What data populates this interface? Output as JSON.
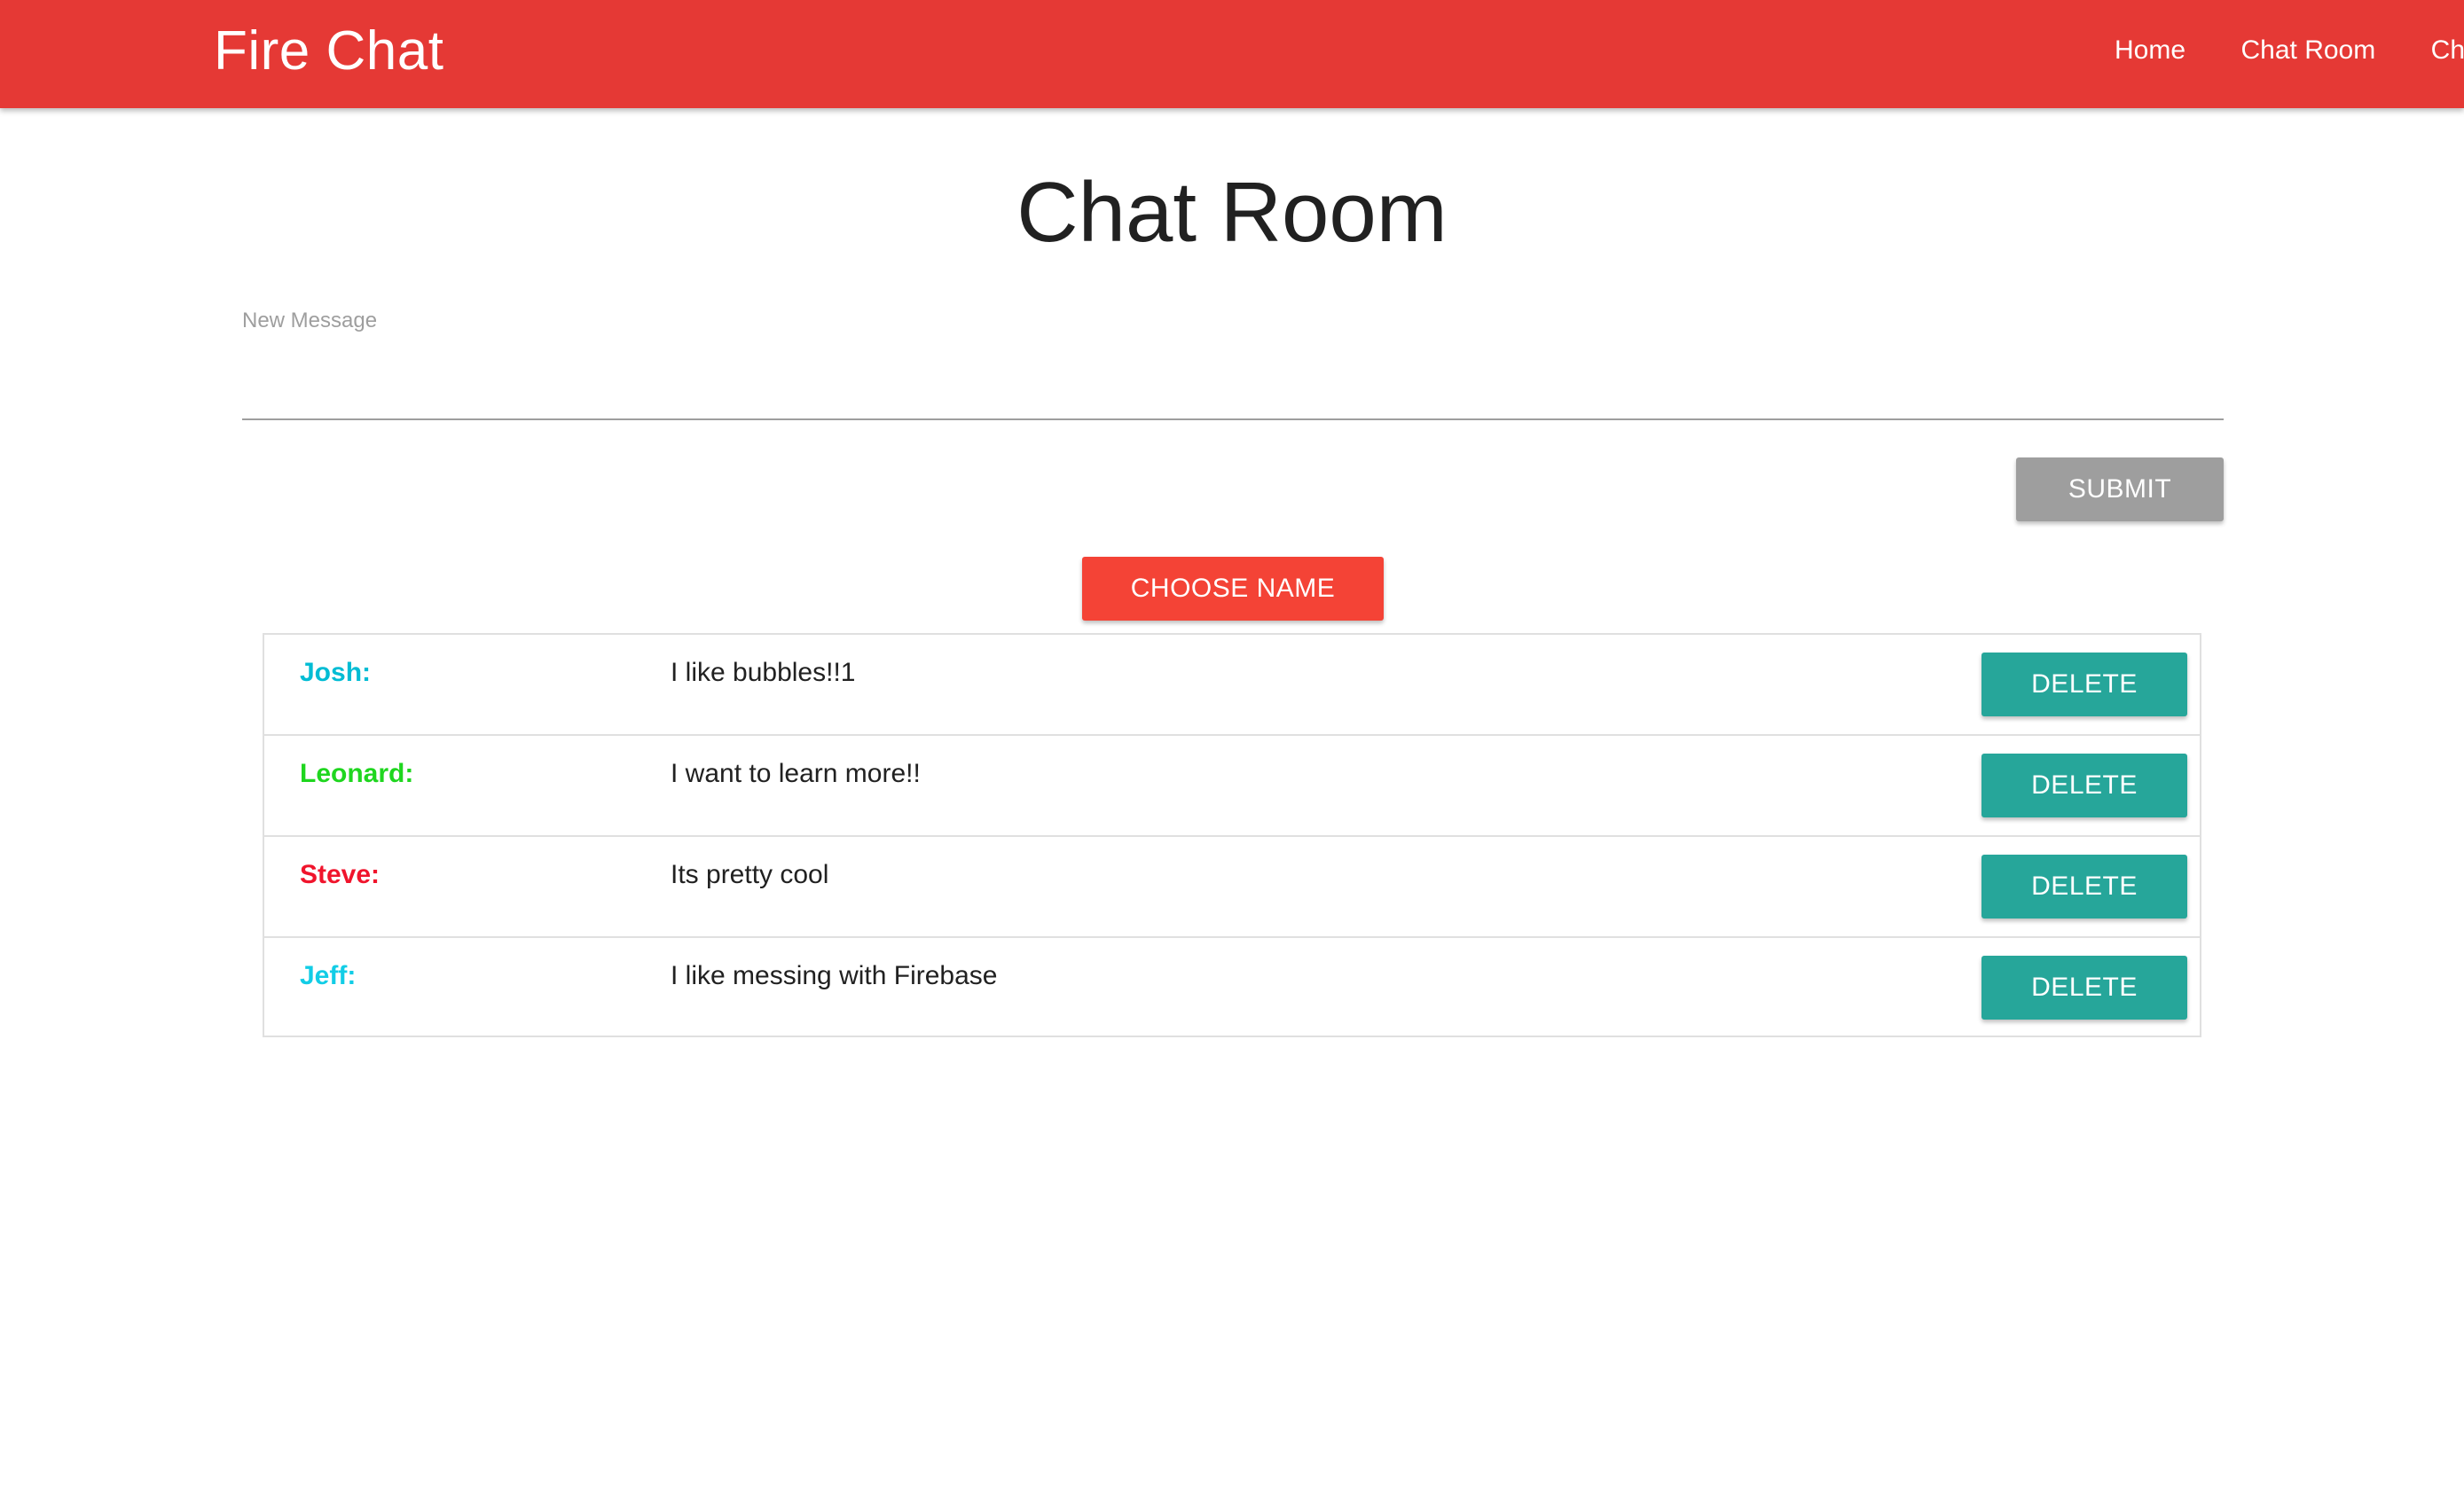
{
  "navbar": {
    "brand": "Fire Chat",
    "links": [
      "Home",
      "Chat Room",
      "Cha"
    ],
    "color": "#e53935"
  },
  "page": {
    "title": "Chat Room"
  },
  "form": {
    "label": "New Message",
    "value": "",
    "submit_label": "SUBMIT",
    "choose_name_label": "CHOOSE NAME"
  },
  "messages": [
    {
      "name": "Josh:",
      "text": "I like bubbles!!1",
      "color": "#00bcd4",
      "delete_label": "DELETE"
    },
    {
      "name": "Leonard:",
      "text": "I want to learn more!!",
      "color": "#1fd61f",
      "delete_label": "DELETE"
    },
    {
      "name": "Steve:",
      "text": "Its pretty cool",
      "color": "#f0142c",
      "delete_label": "DELETE"
    },
    {
      "name": "Jeff:",
      "text": "I like messing with Firebase",
      "color": "#12cde6",
      "delete_label": "DELETE"
    }
  ],
  "colors": {
    "submit": "#9e9e9e",
    "choose": "#f44336",
    "delete": "#26a69a"
  }
}
